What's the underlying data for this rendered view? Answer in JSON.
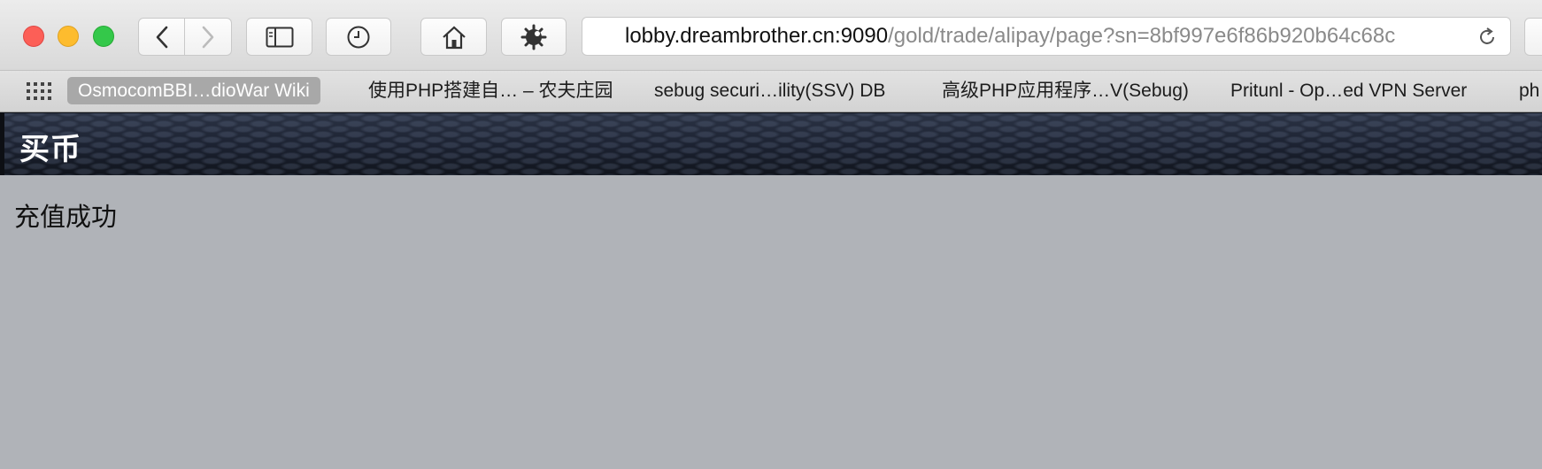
{
  "browser": {
    "url": {
      "host": "lobby.dreambrother.cn:9090",
      "path": "/gold/trade/alipay/page?sn=8bf997e6f86b920b64c68c"
    },
    "icons": {
      "back": "chevron-left-icon",
      "forward": "chevron-right-icon",
      "sidebar": "sidebar-icon",
      "history": "clock-icon",
      "home": "home-icon",
      "extension": "gear-bug-icon",
      "reload": "reload-icon",
      "favorites_grid": "grid-icon"
    }
  },
  "favorites": [
    {
      "label": "OsmocomBBI…dioWar Wiki"
    },
    {
      "label": "使用PHP搭建自… – 农夫庄园"
    },
    {
      "label": "sebug securi…ility(SSV) DB"
    },
    {
      "label": "高级PHP应用程序…V(Sebug)"
    },
    {
      "label": "Pritunl - Op…ed VPN Server"
    },
    {
      "label": "ph"
    }
  ],
  "page": {
    "title": "买币",
    "message": "充值成功"
  },
  "colors": {
    "page_background": "#b0b3b8",
    "header_background": "#1b2130",
    "active_favorite": "#a8a8a8"
  }
}
